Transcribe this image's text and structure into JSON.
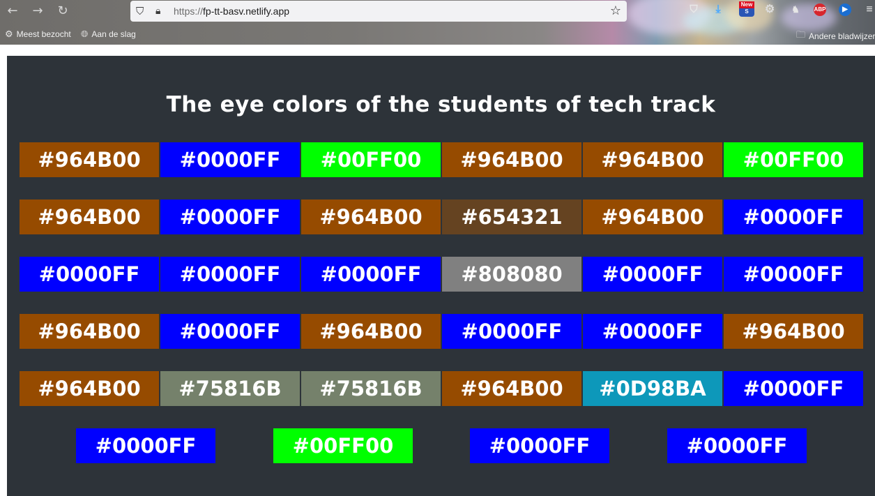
{
  "browser": {
    "url_protocol": "https://",
    "url_host": "fp-tt-basv.netlify.app",
    "bookmarks": [
      {
        "label": "Meest bezocht",
        "icon": "gear-icon"
      },
      {
        "label": "Aan de slag",
        "icon": "globe-icon"
      }
    ],
    "other_bookmarks": "Andere bladwijzers",
    "extension_badge_new": "New",
    "extension_abp": "ABP"
  },
  "page": {
    "title": "The eye colors of the students of tech track",
    "rows": [
      [
        "#964B00",
        "#0000FF",
        "#00FF00",
        "#964B00",
        "#964B00",
        "#00FF00"
      ],
      [
        "#964B00",
        "#0000FF",
        "#964B00",
        "#654321",
        "#964B00",
        "#0000FF"
      ],
      [
        "#0000FF",
        "#0000FF",
        "#0000FF",
        "#808080",
        "#0000FF",
        "#0000FF"
      ],
      [
        "#964B00",
        "#0000FF",
        "#964B00",
        "#0000FF",
        "#0000FF",
        "#964B00"
      ],
      [
        "#964B00",
        "#75816B",
        "#75816B",
        "#964B00",
        "#0D98BA",
        "#0000FF"
      ],
      [
        "#0000FF",
        "#00FF00",
        "#0000FF",
        "#0000FF"
      ]
    ]
  }
}
